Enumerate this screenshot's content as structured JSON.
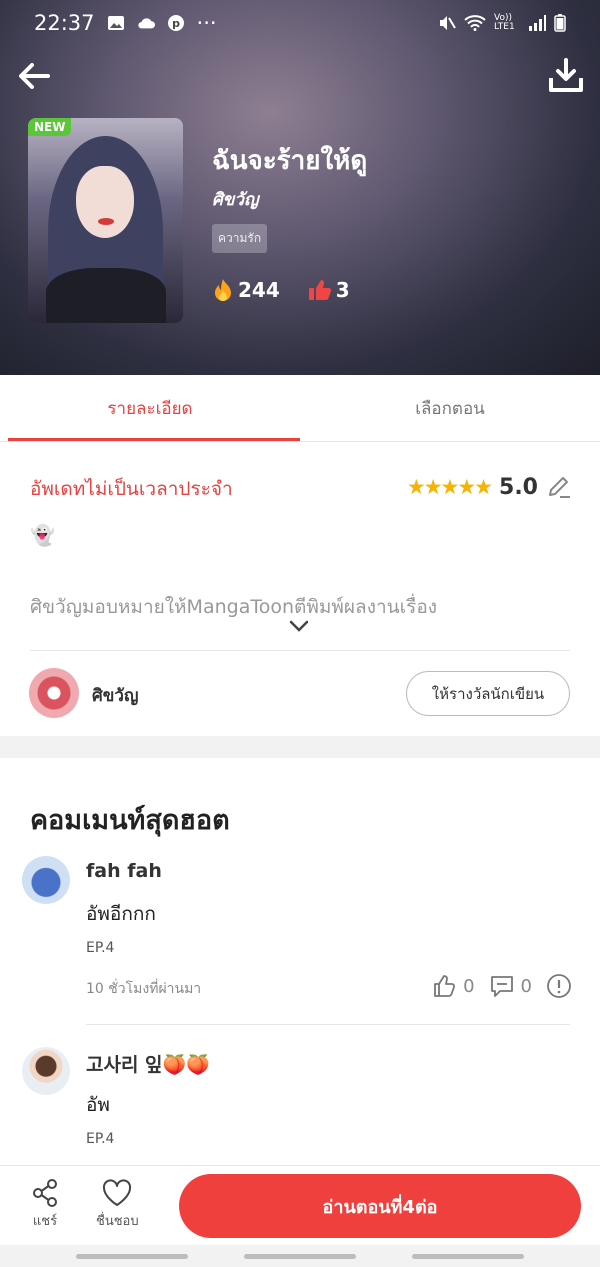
{
  "status_bar": {
    "time": "22:37",
    "dots": "···",
    "network": "Vo)) LTE1"
  },
  "book": {
    "badge": "NEW",
    "title": "ฉันจะร้ายให้ดู",
    "author": "ศิขวัญ",
    "genre": "ความรัก",
    "views": "244",
    "likes": "3"
  },
  "tabs": [
    {
      "label": "รายละเอียด",
      "active": true
    },
    {
      "label": "เลือกตอน",
      "active": false
    }
  ],
  "detail": {
    "update_text": "อัพเดทไม่เป็นเวลาประจำ",
    "stars": "★★★★★",
    "rating": "5.0",
    "emoji": "👻",
    "description": "ศิขวัญมอบหมายให้MangaToonตีพิมพ์ผลงานเรื่อง",
    "author_name": "ศิขวัญ",
    "reward_button": "ให้รางวัลนักเขียน"
  },
  "comments_section": {
    "title": "คอมเมนท์สุดฮอต",
    "comments": [
      {
        "user": "fah fah",
        "text": "อัพอีกกก",
        "episode": "EP.4",
        "time": "10 ชั่วโมงที่ผ่านมา",
        "likes": "0",
        "replies": "0"
      },
      {
        "user": "고사리 잎🍑🍑",
        "text": "อัพ",
        "episode": "EP.4"
      }
    ]
  },
  "bottom_bar": {
    "share_label": "แชร์",
    "like_label": "ชื่นชอบ",
    "read_button": "อ่านตอนที่4ต่อ"
  },
  "colors": {
    "accent": "#e8413f",
    "star": "#f6b400",
    "badge_new": "#5cc63a"
  }
}
